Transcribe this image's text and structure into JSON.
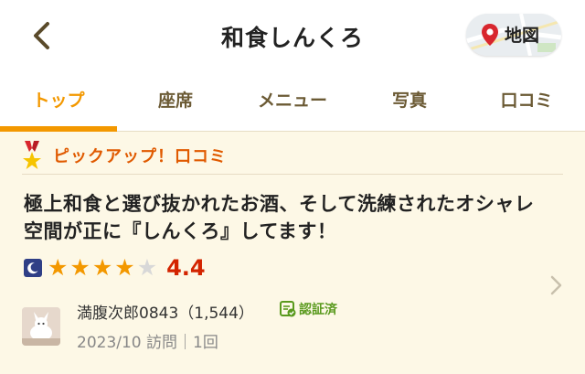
{
  "header": {
    "title": "和食しんくろ",
    "map_label": "地図"
  },
  "tabs": [
    {
      "label": "トップ",
      "active": true
    },
    {
      "label": "座席",
      "active": false
    },
    {
      "label": "メニュー",
      "active": false
    },
    {
      "label": "写真",
      "active": false
    },
    {
      "label": "口コミ",
      "active": false
    }
  ],
  "colors": {
    "accent": "#f39800",
    "pickup": "#e05a00",
    "score": "#d32400",
    "review_bg": "#fdf8e6",
    "verified": "#5a9a1e"
  },
  "review": {
    "pickup_label": "ピックアップ！口コミ",
    "title": "極上和食と選び抜かれたお酒、そして洗練されたオシャレ空間が正に『しんくろ』してます！",
    "rating_icon": "moon-icon",
    "stars_filled": 4,
    "stars_total": 5,
    "score": "4.4",
    "user_name": "満腹次郎0843（1,544）",
    "verified_label": "認証済",
    "visit_info": "2023/10 訪問｜1回"
  }
}
